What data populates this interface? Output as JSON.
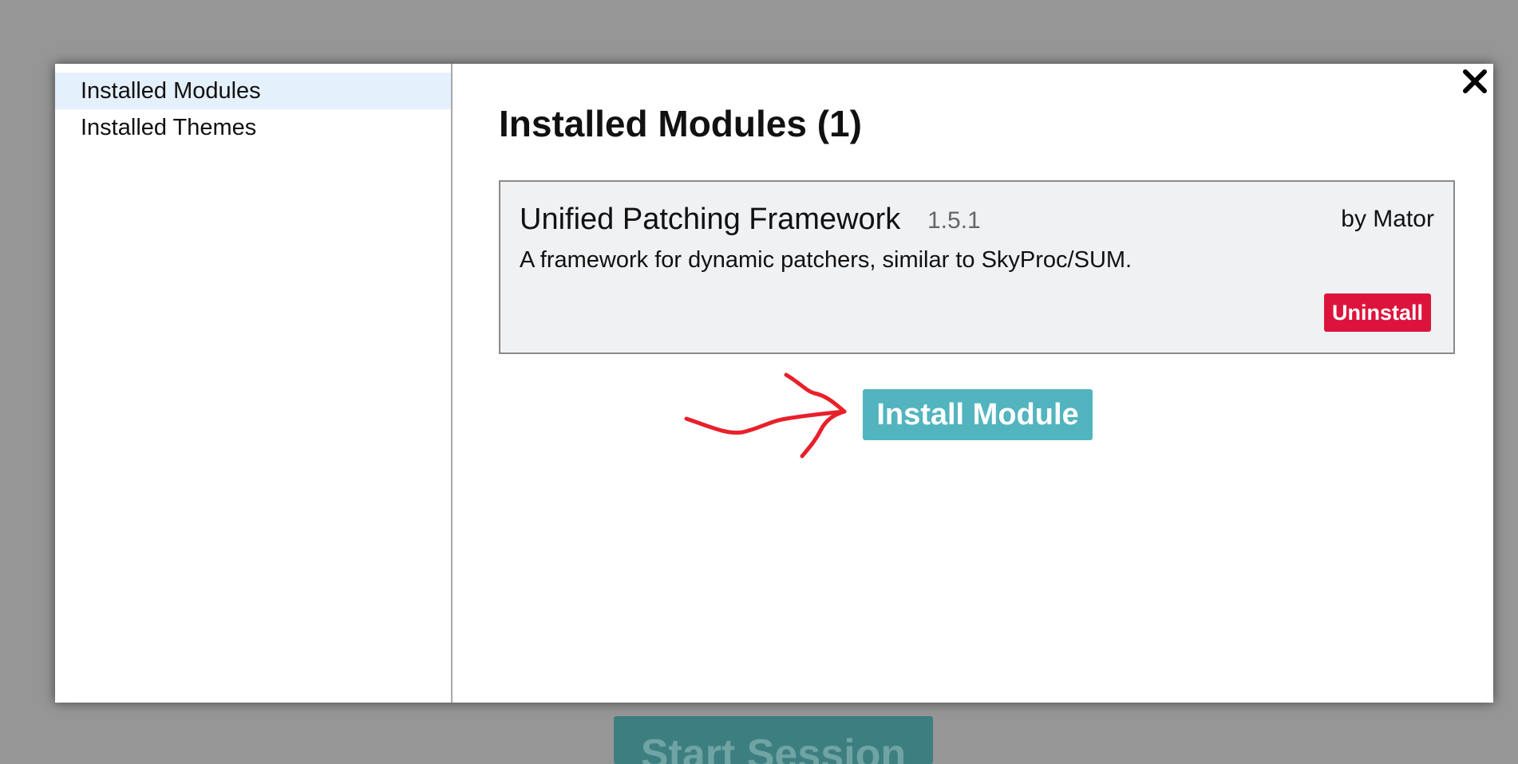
{
  "background": {
    "button_label": "Start Session",
    "button_color": "#3d7f80",
    "overlay_color": "#969696"
  },
  "sidebar": {
    "items": [
      {
        "label": "Installed Modules",
        "active": true
      },
      {
        "label": "Installed Themes",
        "active": false
      }
    ]
  },
  "main": {
    "title": "Installed Modules (1)",
    "modules": [
      {
        "name": "Unified Patching Framework",
        "version": "1.5.1",
        "author": "by Mator",
        "description": "A framework for dynamic patchers, similar to SkyProc/SUM.",
        "uninstall_label": "Uninstall"
      }
    ],
    "install_label": "Install Module"
  },
  "icons": {
    "close": "close-icon",
    "annotation": "red-arrow-annotation"
  },
  "colors": {
    "uninstall": "#dc143c",
    "install": "#52b4bf",
    "active_sidebar": "#e4f0fb",
    "annotation": "#e8202a"
  }
}
